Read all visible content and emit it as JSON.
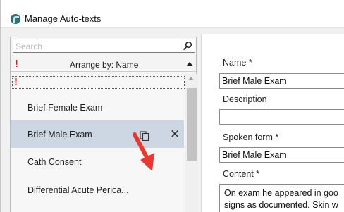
{
  "window": {
    "title": "Manage Auto-texts"
  },
  "colors": {
    "alert": "#e0201b",
    "selection": "#cdd6e3",
    "arrow": "#e8382f"
  },
  "left": {
    "search": {
      "placeholder": "Search"
    },
    "arrange": {
      "marker": "!",
      "label": "Arrange by: Name"
    },
    "list": {
      "empty_marker": "!",
      "items": [
        {
          "label": "Brief Female Exam",
          "selected": false
        },
        {
          "label": "Brief Male Exam",
          "selected": true
        },
        {
          "label": "Cath Consent",
          "selected": false
        },
        {
          "label": "Differential Acute Perica...",
          "selected": false
        }
      ]
    }
  },
  "right": {
    "name": {
      "label": "Name *",
      "value": "Brief Male Exam"
    },
    "description": {
      "label": "Description",
      "value": ""
    },
    "spoken": {
      "label": "Spoken form *",
      "value": "Brief Male Exam"
    },
    "content": {
      "label": "Content *",
      "lines": [
        "On exam he appeared in goo",
        "signs as documented. Skin w"
      ]
    }
  }
}
